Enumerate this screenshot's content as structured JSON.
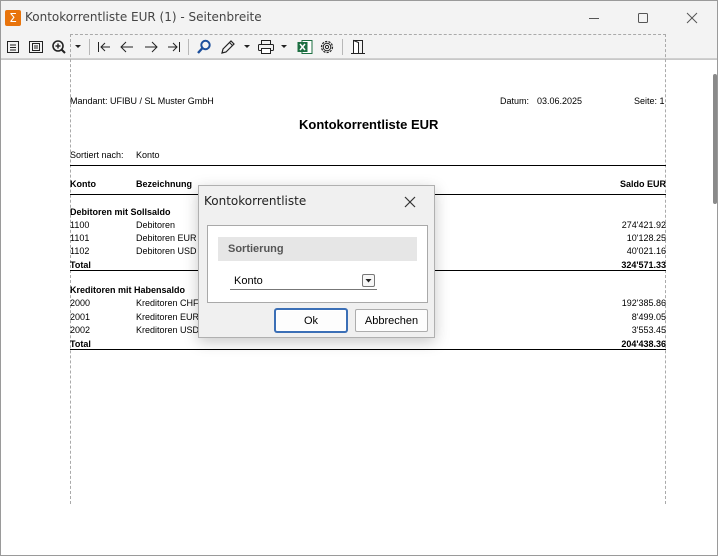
{
  "window": {
    "title": "Kontokorrentliste EUR (1) - Seitenbreite",
    "app_icon_glyph": "Σ",
    "accent_color": "#e8740c"
  },
  "toolbar": {
    "icons": [
      "page-icon",
      "fit-page-icon",
      "zoom-icon",
      "first-page-icon",
      "previous-page-icon",
      "next-page-icon",
      "last-page-icon",
      "search-icon",
      "pencil-icon",
      "print-icon",
      "excel-icon",
      "settings-icon",
      "exit-icon"
    ]
  },
  "report": {
    "mandant": "Mandant: UFIBU / SL Muster GmbH",
    "datum_label": "Datum:",
    "datum_value": "03.06.2025",
    "seite": "Seite: 1",
    "title": "Kontokorrentliste EUR",
    "sort_label": "Sortiert nach:",
    "sort_value": "Konto",
    "col_konto": "Konto",
    "col_bezeichnung": "Bezeichnung",
    "col_saldo": "Saldo EUR",
    "debitoren": {
      "heading": "Debitoren mit Sollsaldo",
      "rows": [
        {
          "konto": "1100",
          "name": "Debitoren",
          "saldo": "274'421.92"
        },
        {
          "konto": "1101",
          "name": "Debitoren EUR",
          "saldo": "10'128.25"
        },
        {
          "konto": "1102",
          "name": "Debitoren USD",
          "saldo": "40'021.16"
        }
      ],
      "total_label": "Total",
      "total_value": "324'571.33"
    },
    "kreditoren": {
      "heading": "Kreditoren mit Habensaldo",
      "rows": [
        {
          "konto": "2000",
          "name": "Kreditoren CHF",
          "saldo": "192'385.86"
        },
        {
          "konto": "2001",
          "name": "Kreditoren EUR",
          "saldo": "8'499.05"
        },
        {
          "konto": "2002",
          "name": "Kreditoren USD",
          "saldo": "3'553.45"
        }
      ],
      "total_label": "Total",
      "total_value": "204'438.36"
    }
  },
  "dialog": {
    "title": "Kontokorrentliste",
    "group_label": "Sortierung",
    "select_value": "Konto",
    "ok_label": "Ok",
    "cancel_label": "Abbrechen"
  }
}
